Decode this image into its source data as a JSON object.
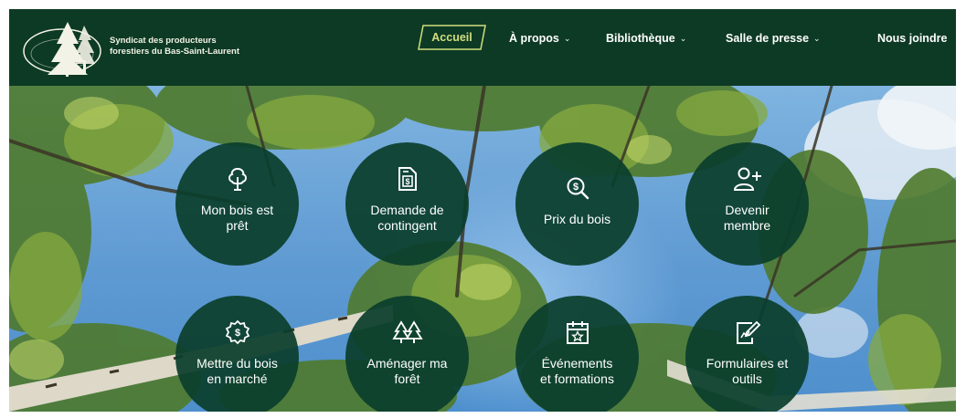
{
  "header": {
    "org_name": "Syndicat des producteurs\nforestiers du Bas-Saint-Laurent",
    "logo_icon": "tree-logo-icon",
    "nav": [
      {
        "label": "Accueil",
        "active": true
      },
      {
        "label": "À propos",
        "dropdown": true
      },
      {
        "label": "Bibliothèque",
        "dropdown": true
      },
      {
        "label": "Salle de presse",
        "dropdown": true
      },
      {
        "label": "Nous joindre"
      }
    ],
    "dropdown_glyph": "⌄"
  },
  "tiles": [
    {
      "label": "Mon bois est\nprêt",
      "icon": "tree-icon"
    },
    {
      "label": "Demande de\ncontingent",
      "icon": "dollar-document-icon"
    },
    {
      "label": "Prix du bois",
      "icon": "dollar-search-icon"
    },
    {
      "label": "Devenir\nmembre",
      "icon": "add-user-icon"
    },
    {
      "label": "Mettre du bois\nen marché",
      "icon": "dollar-badge-icon"
    },
    {
      "label": "Aménager ma\nforêt",
      "icon": "forest-icon"
    },
    {
      "label": "Événements\net formations",
      "icon": "calendar-star-icon"
    },
    {
      "label": "Formulaires et\noutils",
      "icon": "form-edit-icon"
    }
  ],
  "colors": {
    "header_bg": "#0d3a24",
    "tile_bg": "#0b3e2c",
    "active_outline": "#d2de7e",
    "sky": "#5f9ad2"
  }
}
